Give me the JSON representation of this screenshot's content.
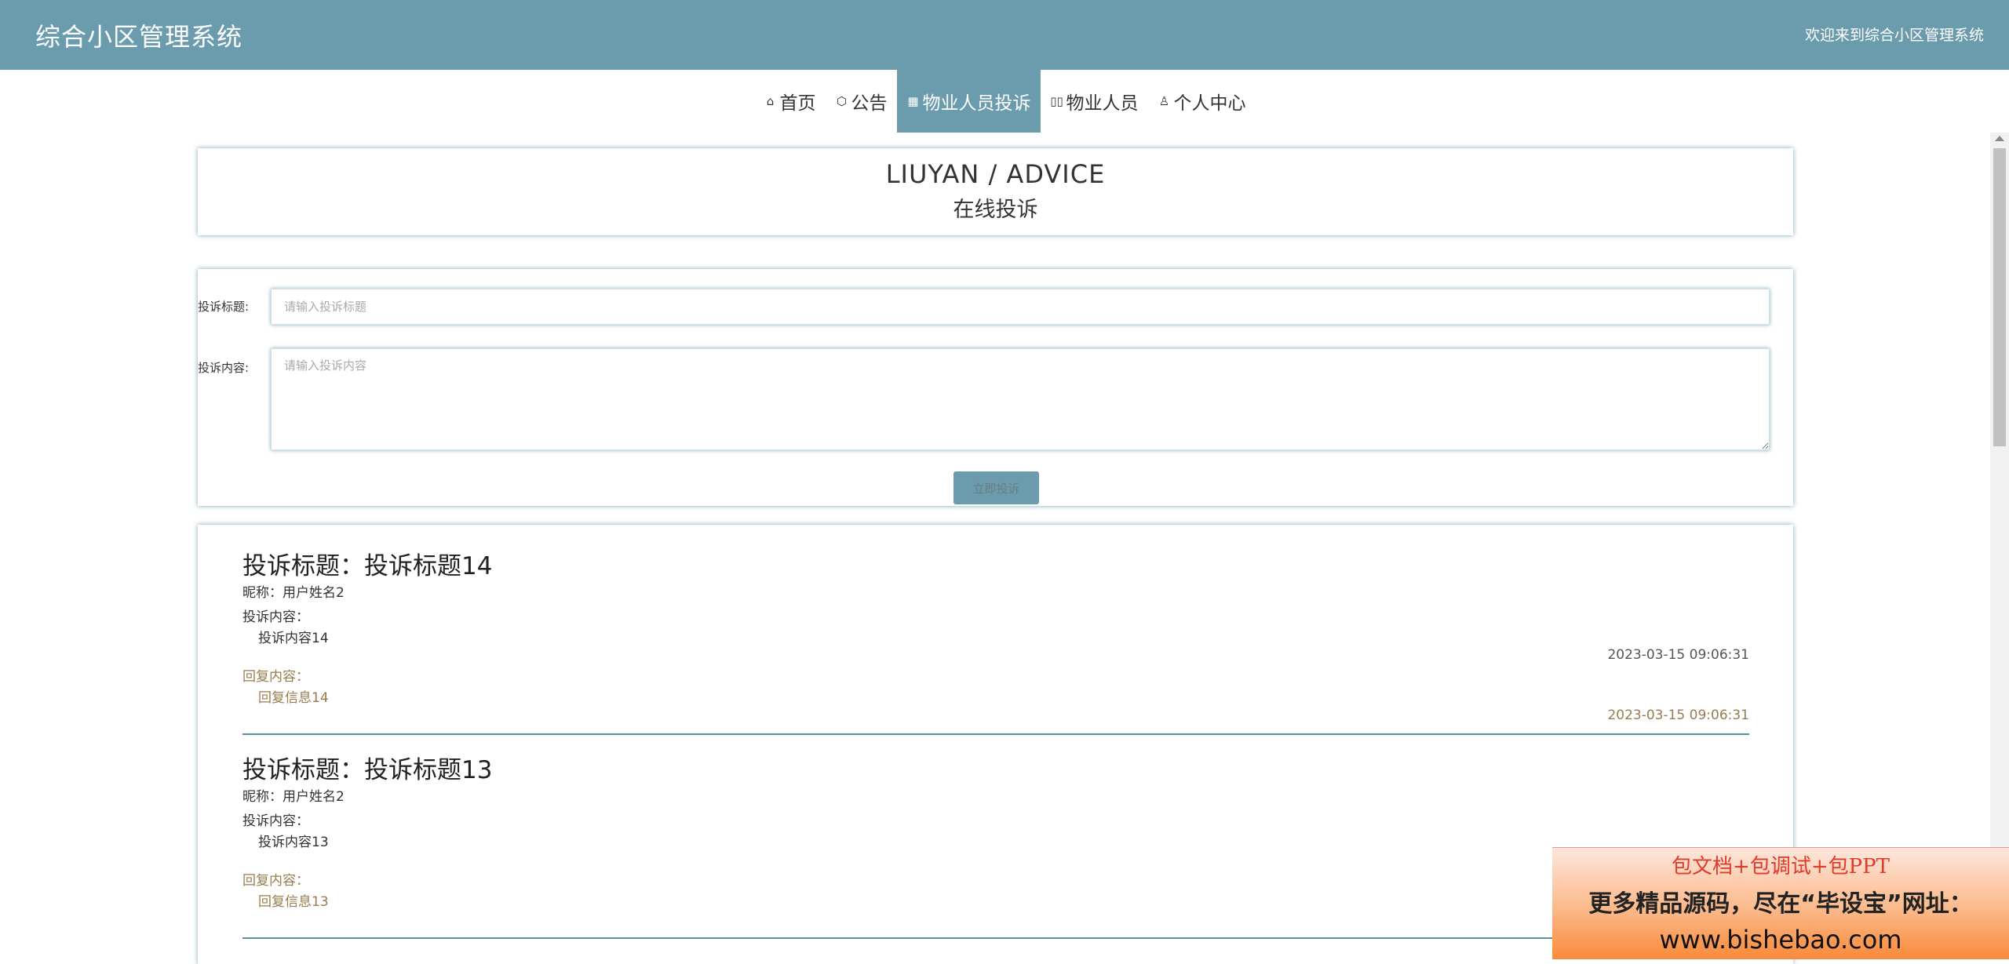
{
  "header": {
    "brand": "综合小区管理系统",
    "welcome": "欢迎来到综合小区管理系统"
  },
  "nav": {
    "items": [
      {
        "icon": "⌂",
        "label": "首页"
      },
      {
        "icon": "⬡",
        "label": "公告"
      },
      {
        "icon": "▦",
        "label": "物业人员投诉"
      },
      {
        "icon": "▯▯",
        "label": "物业人员"
      },
      {
        "icon": "♙",
        "label": "个人中心"
      }
    ],
    "active_index": 2
  },
  "title_panel": {
    "en": "LIUYAN / ADVICE",
    "cn": "在线投诉"
  },
  "form": {
    "title_label": "投诉标题:",
    "title_placeholder": "请输入投诉标题",
    "content_label": "投诉内容:",
    "content_placeholder": "请输入投诉内容",
    "submit_label": "立即投诉"
  },
  "complaints": [
    {
      "title": "投诉标题：投诉标题14",
      "nickname": "昵称：用户姓名2",
      "content_label": "投诉内容：",
      "content": "投诉内容14",
      "content_time": "2023-03-15 09:06:31",
      "reply_label": "回复内容：",
      "reply": "回复信息14",
      "reply_time": "2023-03-15 09:06:31"
    },
    {
      "title": "投诉标题：投诉标题13",
      "nickname": "昵称：用户姓名2",
      "content_label": "投诉内容：",
      "content": "投诉内容13",
      "reply_label": "回复内容：",
      "reply": "回复信息13"
    }
  ],
  "ad": {
    "line1": "包文档+包调试+包PPT",
    "line2": "更多精品源码，尽在“毕设宝”网址：",
    "line3": "www.bishebao.com"
  },
  "colors": {
    "primary": "#6a9cae",
    "reply": "#9a7b4f"
  }
}
